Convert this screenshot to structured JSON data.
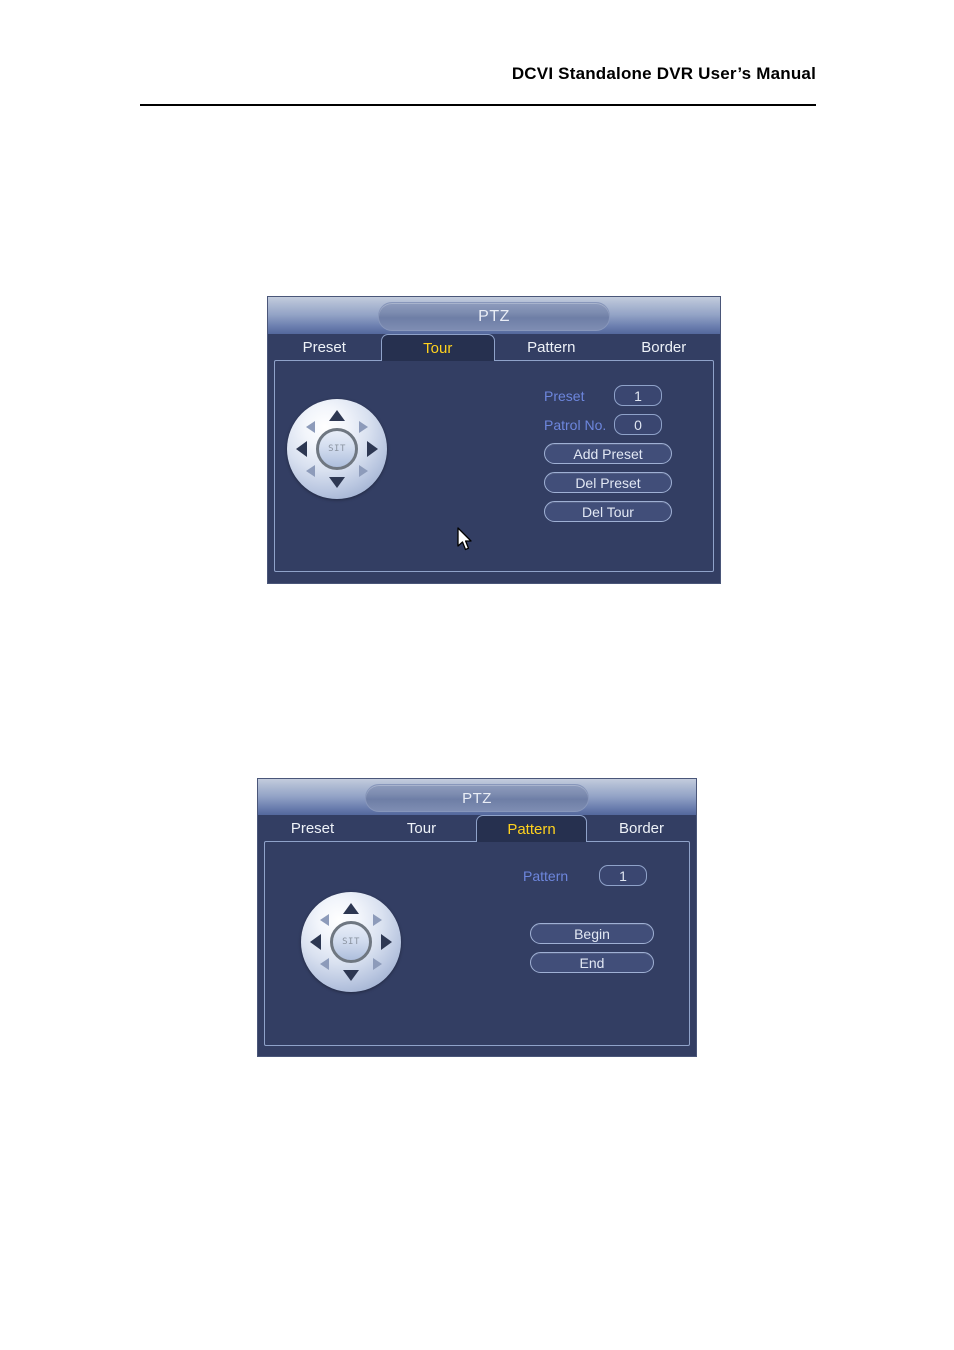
{
  "page": {
    "header_title": "DCVI Standalone DVR User’s Manual"
  },
  "dialogs": [
    {
      "name": "ptz-tour",
      "title": "PTZ",
      "tabs": [
        {
          "label": "Preset",
          "active": false
        },
        {
          "label": "Tour",
          "active": true
        },
        {
          "label": "Pattern",
          "active": false
        },
        {
          "label": "Border",
          "active": false
        }
      ],
      "dpad": {
        "center_label": "SIT",
        "directions": [
          "up",
          "down",
          "left",
          "right",
          "up-left",
          "up-right",
          "down-left",
          "down-right"
        ]
      },
      "fields": [
        {
          "label": "Preset",
          "value": "1"
        },
        {
          "label": "Patrol No.",
          "value": "0"
        }
      ],
      "buttons": [
        {
          "label": "Add Preset"
        },
        {
          "label": "Del Preset"
        },
        {
          "label": "Del Tour"
        }
      ],
      "cursor_visible": true
    },
    {
      "name": "ptz-pattern",
      "title": "PTZ",
      "tabs": [
        {
          "label": "Preset",
          "active": false
        },
        {
          "label": "Tour",
          "active": false
        },
        {
          "label": "Pattern",
          "active": true
        },
        {
          "label": "Border",
          "active": false
        }
      ],
      "dpad": {
        "center_label": "SIT",
        "directions": [
          "up",
          "down",
          "left",
          "right",
          "up-left",
          "up-right",
          "down-left",
          "down-right"
        ]
      },
      "fields": [
        {
          "label": "Pattern",
          "value": "1"
        }
      ],
      "buttons": [
        {
          "label": "Begin"
        },
        {
          "label": "End"
        }
      ],
      "cursor_visible": false
    }
  ],
  "colors": {
    "dialog_bg": "#333e63",
    "panel_border": "#8fa2c9",
    "active_tab_text": "#ffd21e",
    "tab_text": "#eef2f8",
    "label_text": "#6d86dd",
    "button_text": "#e2e8f4"
  }
}
